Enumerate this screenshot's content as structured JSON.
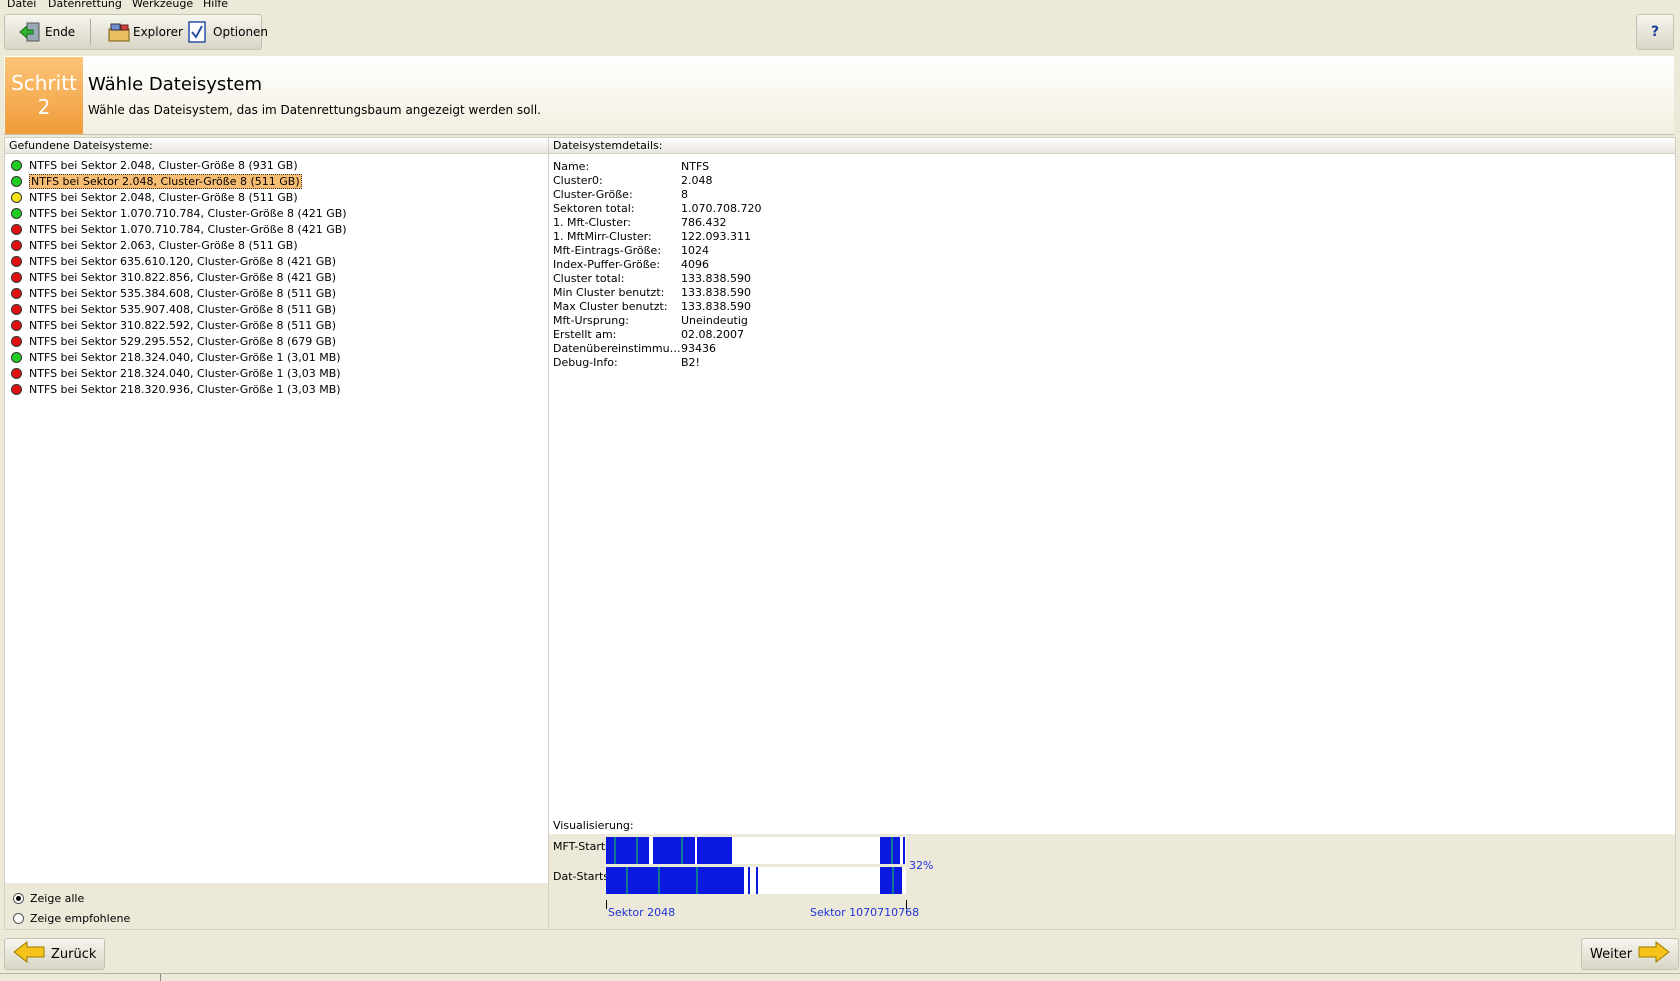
{
  "menu": [
    "Datei",
    "Datenrettung",
    "Werkzeuge",
    "Hilfe"
  ],
  "toolbar": {
    "exit_label": "Ende",
    "explorer_label": "Explorer",
    "options_label": "Optionen",
    "help_label": "?"
  },
  "header": {
    "step_word": "Schritt",
    "step_number": "2",
    "title": "Wähle Dateisystem",
    "subtitle": "Wähle das Dateisystem, das im Datenrettungsbaum angezeigt werden soll."
  },
  "left": {
    "heading": "Gefundene Dateisysteme:",
    "items": [
      {
        "label": "NTFS bei Sektor 2.048, Cluster-Größe 8 (931 GB)",
        "status": "green",
        "selected": false
      },
      {
        "label": "NTFS bei Sektor 2.048, Cluster-Größe 8 (511 GB)",
        "status": "green",
        "selected": true
      },
      {
        "label": "NTFS bei Sektor 2.048, Cluster-Größe 8 (511 GB)",
        "status": "yellow",
        "selected": false
      },
      {
        "label": "NTFS bei Sektor 1.070.710.784, Cluster-Größe 8 (421 GB)",
        "status": "green",
        "selected": false
      },
      {
        "label": "NTFS bei Sektor 1.070.710.784, Cluster-Größe 8 (421 GB)",
        "status": "red",
        "selected": false
      },
      {
        "label": "NTFS bei Sektor 2.063, Cluster-Größe 8 (511 GB)",
        "status": "red",
        "selected": false
      },
      {
        "label": "NTFS bei Sektor 635.610.120, Cluster-Größe 8 (421 GB)",
        "status": "red",
        "selected": false
      },
      {
        "label": "NTFS bei Sektor 310.822.856, Cluster-Größe 8 (421 GB)",
        "status": "red",
        "selected": false
      },
      {
        "label": "NTFS bei Sektor 535.384.608, Cluster-Größe 8 (511 GB)",
        "status": "red",
        "selected": false
      },
      {
        "label": "NTFS bei Sektor 535.907.408, Cluster-Größe 8 (511 GB)",
        "status": "red",
        "selected": false
      },
      {
        "label": "NTFS bei Sektor 310.822.592, Cluster-Größe 8 (511 GB)",
        "status": "red",
        "selected": false
      },
      {
        "label": "NTFS bei Sektor 529.295.552, Cluster-Größe 8 (679 GB)",
        "status": "red",
        "selected": false
      },
      {
        "label": "NTFS bei Sektor 218.324.040, Cluster-Größe 1 (3,01 MB)",
        "status": "green",
        "selected": false
      },
      {
        "label": "NTFS bei Sektor 218.324.040, Cluster-Größe 1 (3,03 MB)",
        "status": "red",
        "selected": false
      },
      {
        "label": "NTFS bei Sektor 218.320.936, Cluster-Größe 1 (3,03 MB)",
        "status": "red",
        "selected": false
      }
    ],
    "radio_all": "Zeige alle",
    "radio_recommended": "Zeige empfohlene"
  },
  "right": {
    "heading": "Dateisystemdetails:",
    "details": [
      {
        "key": "Name:",
        "value": "NTFS"
      },
      {
        "key": "Cluster0:",
        "value": "2.048"
      },
      {
        "key": "Cluster-Größe:",
        "value": "8"
      },
      {
        "key": "Sektoren total:",
        "value": "1.070.708.720"
      },
      {
        "key": "1. Mft-Cluster:",
        "value": "786.432"
      },
      {
        "key": "1. MftMirr-Cluster:",
        "value": "122.093.311"
      },
      {
        "key": "Mft-Eintrags-Größe:",
        "value": "1024"
      },
      {
        "key": "Index-Puffer-Größe:",
        "value": "4096"
      },
      {
        "key": "Cluster total:",
        "value": "133.838.590"
      },
      {
        "key": "Min Cluster benutzt:",
        "value": "133.838.590"
      },
      {
        "key": "Max Cluster benutzt:",
        "value": "133.838.590"
      },
      {
        "key": "Mft-Ursprung:",
        "value": "Uneindeutig"
      },
      {
        "key": "Erstellt am:",
        "value": "02.08.2007"
      },
      {
        "key": "Datenübereinstimmun...",
        "value": "93436"
      },
      {
        "key": "Debug-Info:",
        "value": "B2!"
      }
    ],
    "viz_heading": "Visualisierung:",
    "mft_label": "MFT-Starts:",
    "dat_label": "Dat-Starts:",
    "percent": "32%",
    "axis_start": "Sektor 2048",
    "axis_end": "Sektor 1070710768"
  },
  "nav": {
    "back_label": "Zurück",
    "next_label": "Weiter"
  },
  "colors": {
    "status_green": "#22cc22",
    "status_yellow": "#f5e61a",
    "status_red": "#e01010",
    "step_orange": "#f09b38",
    "viz_blue": "#0b19e0"
  }
}
